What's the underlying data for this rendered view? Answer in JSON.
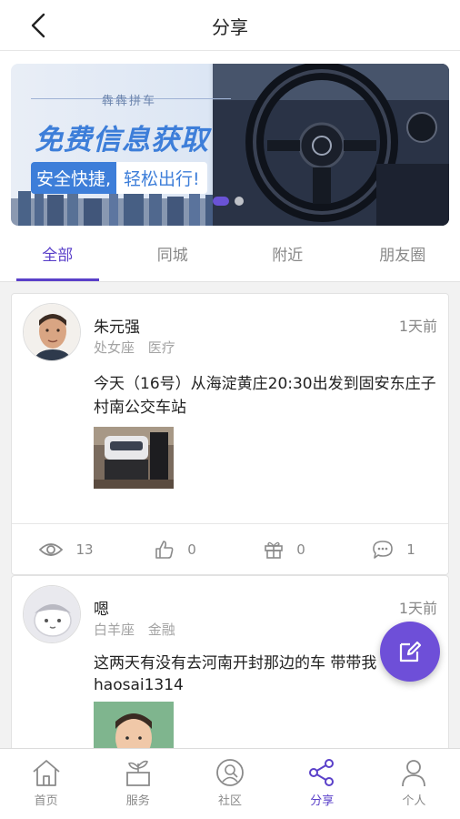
{
  "header": {
    "title": "分享"
  },
  "banner": {
    "brand": "犇犇拼车",
    "headline": "免费信息获取",
    "sub_a": "安全快捷,",
    "sub_b": "轻松出行!"
  },
  "tabs": [
    {
      "label": "全部",
      "active": true
    },
    {
      "label": "同城",
      "active": false
    },
    {
      "label": "附近",
      "active": false
    },
    {
      "label": "朋友圈",
      "active": false
    }
  ],
  "posts": [
    {
      "name": "朱元强",
      "zodiac": "处女座",
      "industry": "医疗",
      "time": "1天前",
      "text": "今天（16号）从海淀黄庄20:30出发到固安东庄子村南公交车站",
      "views": "13",
      "likes": "0",
      "gifts": "0",
      "comments": "1"
    },
    {
      "name": "嗯",
      "zodiac": "白羊座",
      "industry": "金融",
      "time": "1天前",
      "text_line1": "这两天有没有去河南开封那边的车 带带我",
      "text_line2": "haosai1314"
    }
  ],
  "nav": [
    {
      "label": "首页",
      "icon": "home-icon",
      "active": false
    },
    {
      "label": "服务",
      "icon": "plant-pot-icon",
      "active": false
    },
    {
      "label": "社区",
      "icon": "search-user-icon",
      "active": false
    },
    {
      "label": "分享",
      "icon": "share-icon",
      "active": true
    },
    {
      "label": "个人",
      "icon": "person-icon",
      "active": false
    }
  ],
  "colors": {
    "accent": "#5a40c9",
    "fab": "#6e4fd8",
    "banner_blue": "#3d7ed9"
  }
}
